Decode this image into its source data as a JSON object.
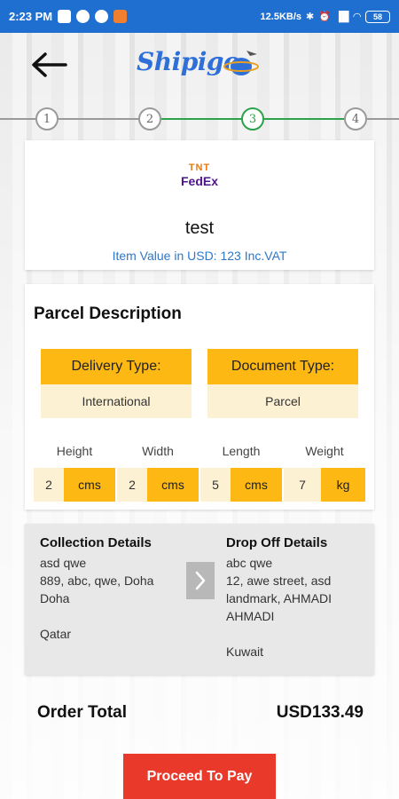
{
  "status_bar": {
    "time": "2:23 PM",
    "network_speed": "12.5KB/s",
    "battery": "58"
  },
  "header": {
    "logo_text": "Shipigo",
    "back_icon": "arrow-left-icon"
  },
  "stepper": {
    "steps": [
      "1",
      "2",
      "3",
      "4"
    ],
    "active_step": "3"
  },
  "item": {
    "carrier_logo_top": "TNT",
    "carrier_logo_bottom": "FedEx",
    "name": "test",
    "value_text": "Item Value in USD: 123 Inc.VAT"
  },
  "parcel": {
    "title": "Parcel Description",
    "delivery_type_label": "Delivery Type:",
    "delivery_type_value": "International",
    "document_type_label": "Document Type:",
    "document_type_value": "Parcel",
    "dimensions": {
      "height_label": "Height",
      "width_label": "Width",
      "length_label": "Length",
      "weight_label": "Weight",
      "height_value": "2",
      "height_unit": "cms",
      "width_value": "2",
      "width_unit": "cms",
      "length_value": "5",
      "length_unit": "cms",
      "weight_value": "7",
      "weight_unit": "kg"
    }
  },
  "collection": {
    "title": "Collection Details",
    "name": "asd qwe",
    "address_line1": "889, abc, qwe, Doha",
    "address_line2": "Doha",
    "country": "Qatar"
  },
  "dropoff": {
    "title": "Drop Off Details",
    "name": "abc qwe",
    "address_line1": "12, awe street, asd",
    "address_line2": "landmark, AHMADI",
    "address_line3": "AHMADI",
    "country": "Kuwait"
  },
  "order": {
    "total_label": "Order Total",
    "total_value": "USD133.49"
  },
  "actions": {
    "proceed_label": "Proceed To Pay"
  },
  "colors": {
    "status_bar": "#1f6fd1",
    "accent_yellow": "#fdb813",
    "light_yellow": "#fdf1d3",
    "step_active": "#2ca24a",
    "pay_button": "#e8392b",
    "link_blue": "#2f78c8"
  }
}
